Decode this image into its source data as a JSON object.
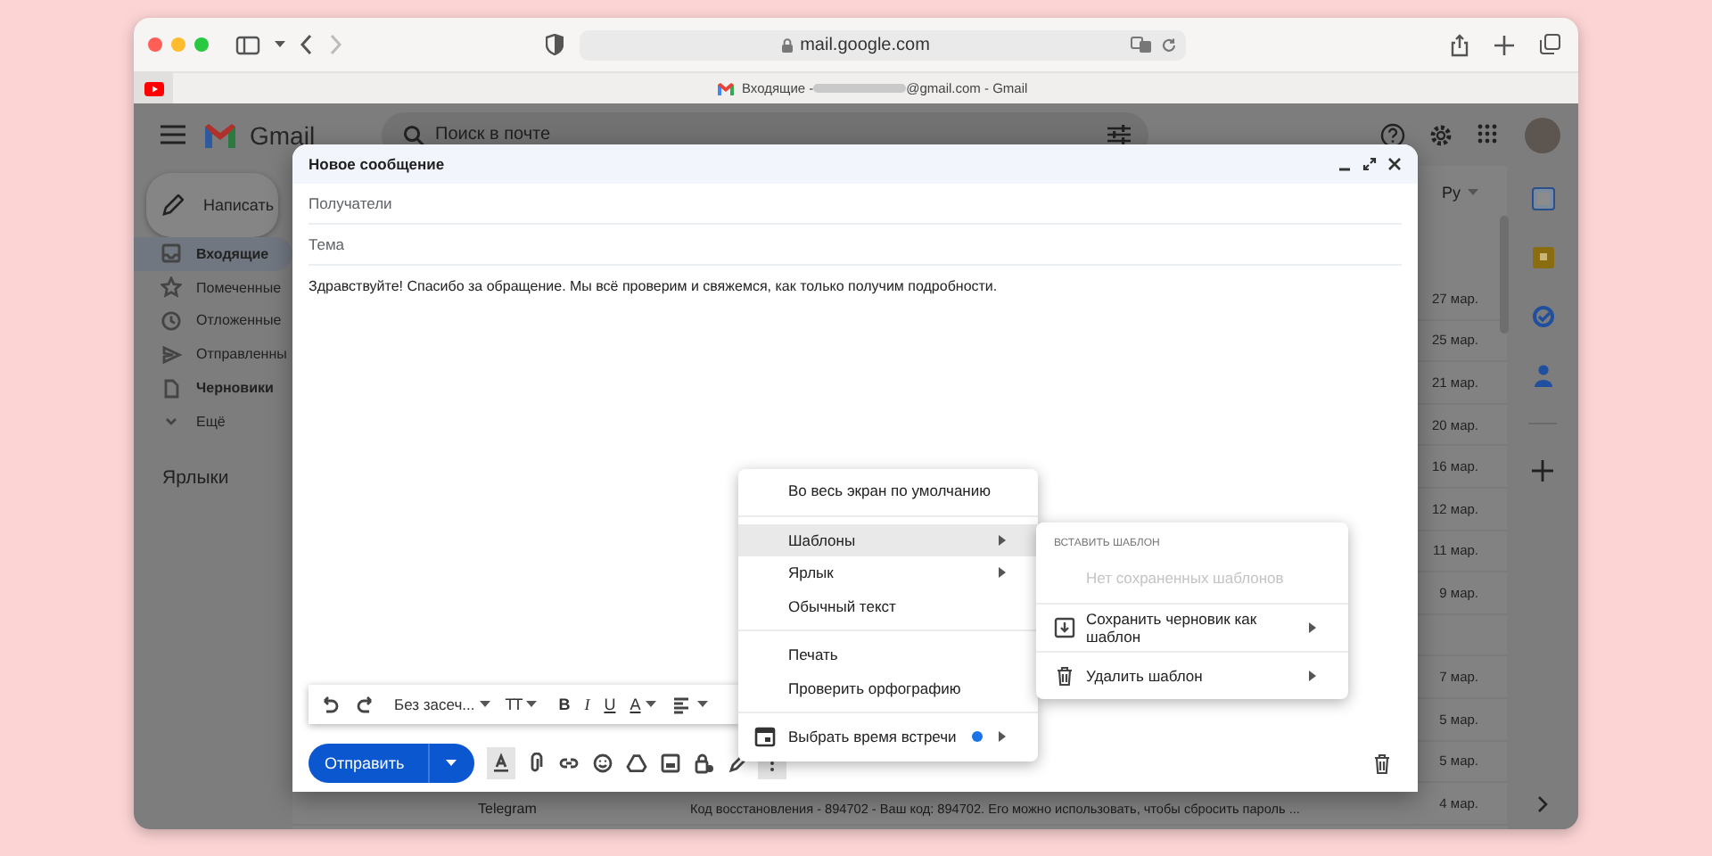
{
  "browser": {
    "url": "mail.google.com",
    "tab_title_start": "Входящие - ",
    "tab_title_end": "@gmail.com - Gmail"
  },
  "gmail": {
    "logo": "Gmail",
    "search_placeholder": "Поиск в почте",
    "compose_button": "Написать",
    "nav": [
      {
        "label": "Входящие",
        "selected": true,
        "unread": true
      },
      {
        "label": "Помеченные",
        "selected": false,
        "unread": false
      },
      {
        "label": "Отложенные",
        "selected": false,
        "unread": false
      },
      {
        "label": "Отправленны",
        "selected": false,
        "unread": false
      },
      {
        "label": "Черновики",
        "selected": false,
        "unread": true
      },
      {
        "label": "Ещё",
        "selected": false,
        "unread": false
      }
    ],
    "labels_heading": "Ярлыки",
    "language": "Ру",
    "rows": [
      {
        "kind": "mail",
        "date": "27 мар."
      },
      {
        "kind": "mail",
        "date": "25 мар."
      },
      {
        "kind": "mail",
        "date": "21 мар."
      },
      {
        "kind": "mail",
        "date": "20 мар."
      },
      {
        "kind": "mail",
        "date": "16 мар."
      },
      {
        "kind": "mail",
        "date": "12 мар."
      },
      {
        "kind": "mail",
        "date": "11 мар."
      },
      {
        "kind": "mail",
        "date": "9 мар."
      },
      {
        "kind": "blank"
      },
      {
        "kind": "mail",
        "date": "7 мар."
      },
      {
        "kind": "mail",
        "date": "5 мар."
      },
      {
        "kind": "mail",
        "date": "5 мар."
      },
      {
        "kind": "mail",
        "date": "4 мар.",
        "sender": "Telegram",
        "snippet": "Код восстановления - 894702 - Ваш код: 894702. Его можно использовать, чтобы сбросить пароль ..."
      }
    ]
  },
  "compose": {
    "title": "Новое сообщение",
    "to_placeholder": "Получатели",
    "subject_placeholder": "Тема",
    "body": "Здравствуйте! Спасибо за обращение. Мы всё проверим и свяжемся, как только получим подробности.",
    "format_tools": [
      {
        "kind": "undo"
      },
      {
        "kind": "redo"
      },
      {
        "kind": "font",
        "label": "Без засеч..."
      },
      {
        "kind": "size",
        "label": "TT"
      },
      {
        "kind": "bold",
        "label": "B"
      },
      {
        "kind": "italic",
        "label": "I"
      },
      {
        "kind": "underline",
        "label": "U"
      },
      {
        "kind": "color",
        "label": "A"
      },
      {
        "kind": "align"
      }
    ],
    "send": "Отправить",
    "tools": [
      {
        "kind": "formatting",
        "selected": true
      },
      {
        "kind": "attach",
        "selected": false
      },
      {
        "kind": "link",
        "selected": false
      },
      {
        "kind": "emoji",
        "selected": false
      },
      {
        "kind": "drive",
        "selected": false
      },
      {
        "kind": "photo",
        "selected": false
      },
      {
        "kind": "lock",
        "selected": false
      },
      {
        "kind": "pen",
        "selected": false
      },
      {
        "kind": "more",
        "selected": true
      }
    ]
  },
  "more_menu": {
    "items": [
      {
        "kind": "item",
        "label": "Во весь экран по умолчанию",
        "selected": false,
        "submenu": false,
        "new_dot": false
      },
      {
        "kind": "divider"
      },
      {
        "kind": "item",
        "label": "Шаблоны",
        "selected": true,
        "submenu": true,
        "new_dot": false
      },
      {
        "kind": "item",
        "label": "Ярлык",
        "selected": false,
        "submenu": true,
        "new_dot": false
      },
      {
        "kind": "item",
        "label": "Обычный текст",
        "selected": false,
        "submenu": false,
        "new_dot": false
      },
      {
        "kind": "divider"
      },
      {
        "kind": "item",
        "label": "Печать",
        "selected": false,
        "submenu": false,
        "new_dot": false
      },
      {
        "kind": "item",
        "label": "Проверить орфографию",
        "selected": false,
        "submenu": false,
        "new_dot": false
      },
      {
        "kind": "divider"
      },
      {
        "kind": "calendar",
        "label": "Выбрать время встречи",
        "selected": false,
        "submenu": true,
        "new_dot": true
      }
    ]
  },
  "templates_menu": {
    "heading": "ВСТАВИТЬ ШАБЛОН",
    "items": [
      {
        "kind": "empty",
        "label": "Нет сохраненных шаблонов",
        "disabled": true,
        "submenu": false
      },
      {
        "kind": "divider"
      },
      {
        "kind": "save",
        "label": "Сохранить черновик как шаблон",
        "disabled": false,
        "submenu": true
      },
      {
        "kind": "divider"
      },
      {
        "kind": "delete",
        "label": "Удалить шаблон",
        "disabled": false,
        "submenu": true
      }
    ]
  }
}
